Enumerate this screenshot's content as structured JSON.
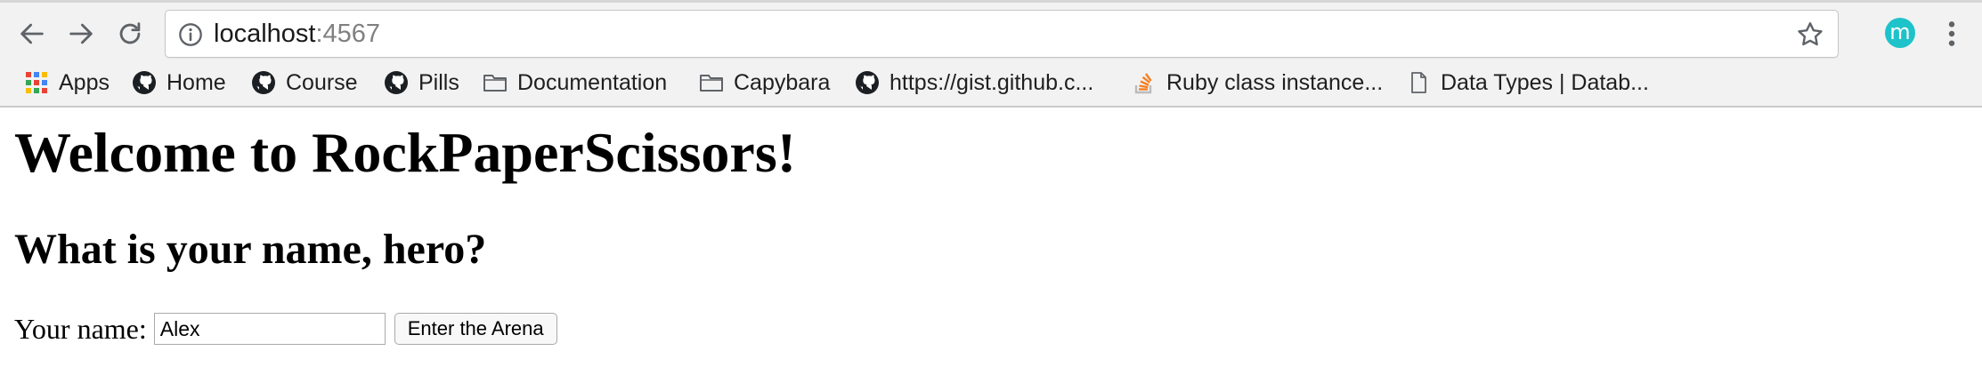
{
  "browser": {
    "url_host": "localhost",
    "url_port": ":4567",
    "profile_initial": "m",
    "bookmarks": [
      {
        "label": "Apps",
        "icon": "apps-grid-icon"
      },
      {
        "label": "Home",
        "icon": "github-icon"
      },
      {
        "label": "Course",
        "icon": "github-icon"
      },
      {
        "label": "Pills",
        "icon": "github-icon"
      },
      {
        "label": "Documentation",
        "icon": "folder-icon"
      },
      {
        "label": "Capybara",
        "icon": "folder-icon"
      },
      {
        "label": "https://gist.github.c...",
        "icon": "github-icon"
      },
      {
        "label": "Ruby class instance...",
        "icon": "stackoverflow-icon"
      },
      {
        "label": "Data Types | Datab...",
        "icon": "page-icon"
      }
    ],
    "colors": {
      "chrome_bg": "#f2f2f2",
      "avatar_bg": "#1ec3c9",
      "port_text": "#808080"
    }
  },
  "page": {
    "title": "Welcome to RockPaperScissors!",
    "subtitle": "What is your name, hero?",
    "form": {
      "label": "Your name:",
      "input_value": "Alex",
      "submit_label": "Enter the Arena"
    }
  }
}
